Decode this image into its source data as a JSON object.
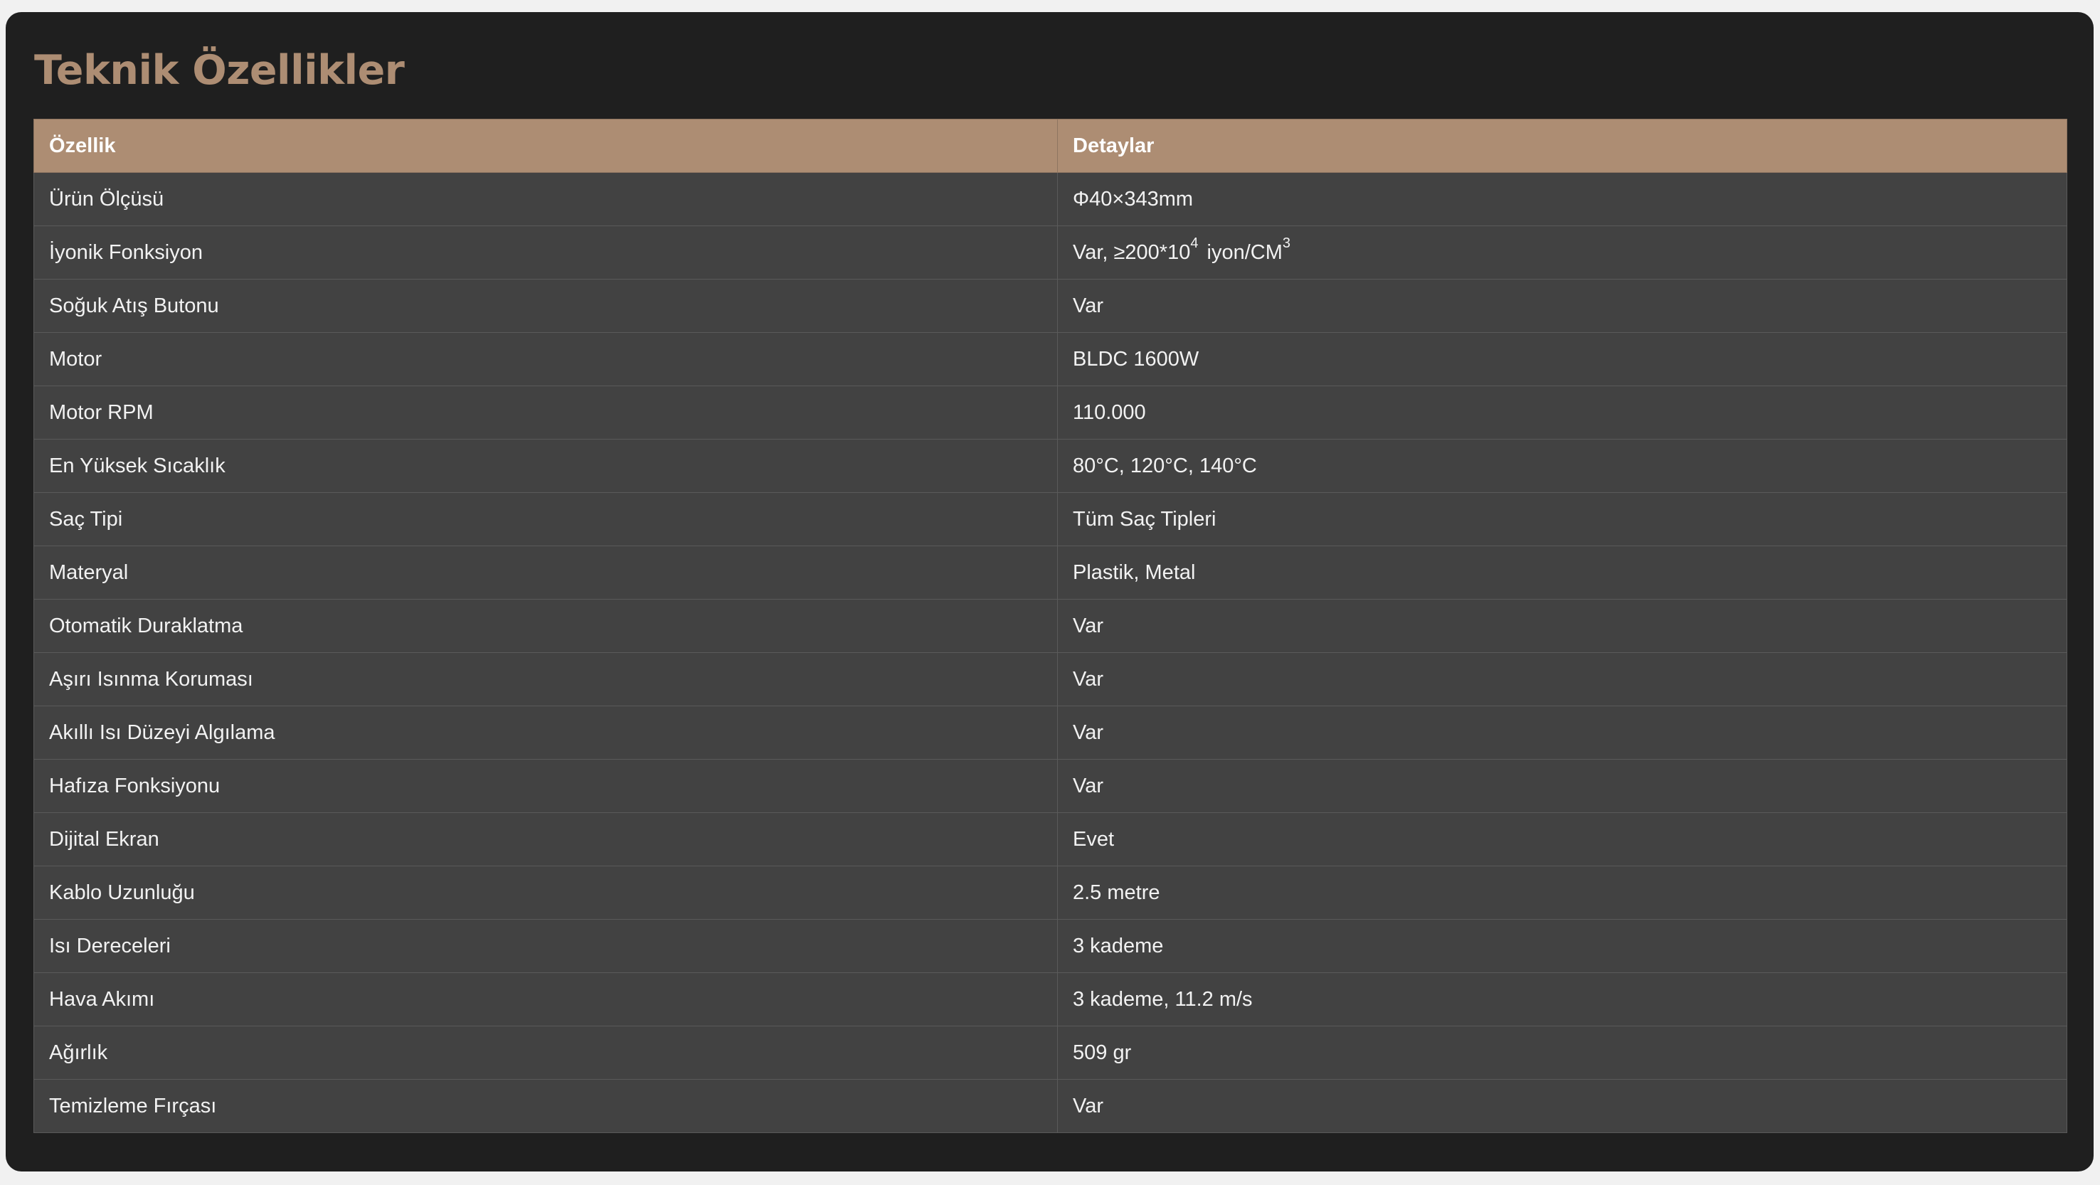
{
  "page": {
    "title": "Teknik Özellikler"
  },
  "table": {
    "headers": [
      "Özellik",
      "Detaylar"
    ],
    "rows": [
      {
        "feature": "Ürün Ölçüsü",
        "detail": "Φ40×343mm"
      },
      {
        "feature": "İyonik Fonksiyon",
        "detail_parts": {
          "prefix": "Var, ≥200*10",
          "exp1": "4",
          "middle": " iyon/CM",
          "exp2": "3"
        }
      },
      {
        "feature": "Soğuk Atış Butonu",
        "detail": "Var"
      },
      {
        "feature": "Motor",
        "detail": "BLDC 1600W"
      },
      {
        "feature": "Motor RPM",
        "detail": "110.000"
      },
      {
        "feature": "En Yüksek Sıcaklık",
        "detail": "80°C, 120°C, 140°C"
      },
      {
        "feature": "Saç Tipi",
        "detail": "Tüm Saç Tipleri"
      },
      {
        "feature": "Materyal",
        "detail": "Plastik, Metal"
      },
      {
        "feature": "Otomatik Duraklatma",
        "detail": "Var"
      },
      {
        "feature": "Aşırı Isınma Koruması",
        "detail": "Var"
      },
      {
        "feature": "Akıllı Isı Düzeyi Algılama",
        "detail": "Var"
      },
      {
        "feature": "Hafıza Fonksiyonu",
        "detail": "Var"
      },
      {
        "feature": "Dijital Ekran",
        "detail": "Evet"
      },
      {
        "feature": "Kablo Uzunluğu",
        "detail": "2.5 metre"
      },
      {
        "feature": "Isı Dereceleri",
        "detail": "3 kademe"
      },
      {
        "feature": "Hava Akımı",
        "detail": "3 kademe, 11.2 m/s"
      },
      {
        "feature": "Ağırlık",
        "detail": "509 gr"
      },
      {
        "feature": "Temizleme Fırçası",
        "detail": "Var"
      }
    ]
  },
  "colors": {
    "accent": "#ad8d73",
    "panel_background": "#1f1f1f",
    "row_background": "#424242"
  }
}
